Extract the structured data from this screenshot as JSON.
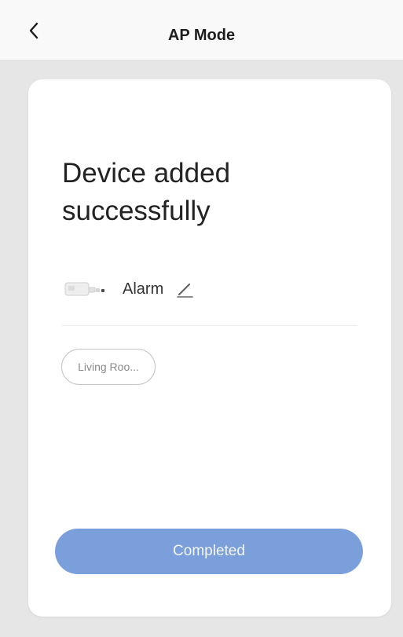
{
  "header": {
    "title": "AP Mode",
    "back_icon": "chevron-left-icon"
  },
  "card": {
    "headline": "Device added successfully",
    "device": {
      "icon": "alarm-device-icon",
      "name": "Alarm",
      "edit_icon": "pencil-icon"
    },
    "room_chip": "Living Roo...",
    "complete_button": "Completed"
  },
  "colors": {
    "accent": "#7b9fdb",
    "background": "#e6e6e6",
    "card": "#ffffff"
  }
}
